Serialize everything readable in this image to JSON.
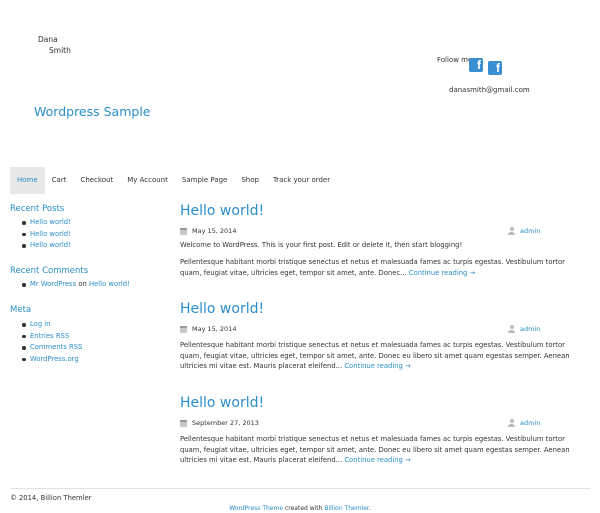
{
  "header": {
    "name_first": "Dana",
    "name_last": "Smith",
    "site_title": "Wordpress Sample",
    "follow_label": "Follow me",
    "social_icons": [
      "facebook-icon",
      "facebook-icon"
    ],
    "email": "danasmith@gmail.com"
  },
  "nav": {
    "items": [
      "Home",
      "Cart",
      "Checkout",
      "My Account",
      "Sample Page",
      "Shop",
      "Track your order"
    ],
    "active": "Home"
  },
  "sidebar": {
    "recent_posts": {
      "title": "Recent Posts",
      "items": [
        "Hello world!",
        "Hello world!",
        "Hello world!"
      ]
    },
    "recent_comments": {
      "title": "Recent Comments",
      "items": [
        {
          "author": "Mr WordPress",
          "on": "on",
          "post": "Hello world!"
        }
      ]
    },
    "meta": {
      "title": "Meta",
      "items": [
        "Log in",
        "Entries RSS",
        "Comments RSS",
        "WordPress.org"
      ]
    }
  },
  "posts": [
    {
      "title": "Hello world!",
      "date": "May 15, 2014",
      "author": "admin",
      "excerpt": "Welcome to WordPress. This is your first post. Edit or delete it, then start blogging!",
      "body": "Pellentesque habitant morbi tristique senectus et netus et malesuada fames ac turpis egestas. Vestibulum tortor quam, feugiat vitae, ultricies eget, tempor sit amet, ante. Donec...",
      "more": "Continue reading →"
    },
    {
      "title": "Hello world!",
      "date": "May 15, 2014",
      "author": "admin",
      "body": "Pellentesque habitant morbi tristique senectus et netus et malesuada fames ac turpis egestas. Vestibulum tortor quam, feugiat vitae, ultricies eget, tempor sit amet, ante. Donec eu libero sit amet quam egestas semper. Aenean ultricies mi vitae est. Mauris placerat eleifend...",
      "more": "Continue reading →"
    },
    {
      "title": "Hello world!",
      "date": "September 27, 2013",
      "author": "admin",
      "body": "Pellentesque habitant morbi tristique senectus et netus et malesuada fames ac turpis egestas. Vestibulum tortor quam, feugiat vitae, ultricies eget, tempor sit amet, ante. Donec eu libero sit amet quam egestas semper. Aenean ultricies mi vitae est. Mauris placerat eleifend...",
      "more": "Continue reading →"
    }
  ],
  "footer": {
    "copyright": "© 2014, Billion Themler",
    "theme_link": "WordPress Theme",
    "created_with": "created with",
    "builder_link": "Billion Themler",
    "period": "."
  },
  "colors": {
    "accent": "#2a8ec8",
    "facebook": "#3a8fd0",
    "nav_active_bg": "#e8e8e8"
  }
}
